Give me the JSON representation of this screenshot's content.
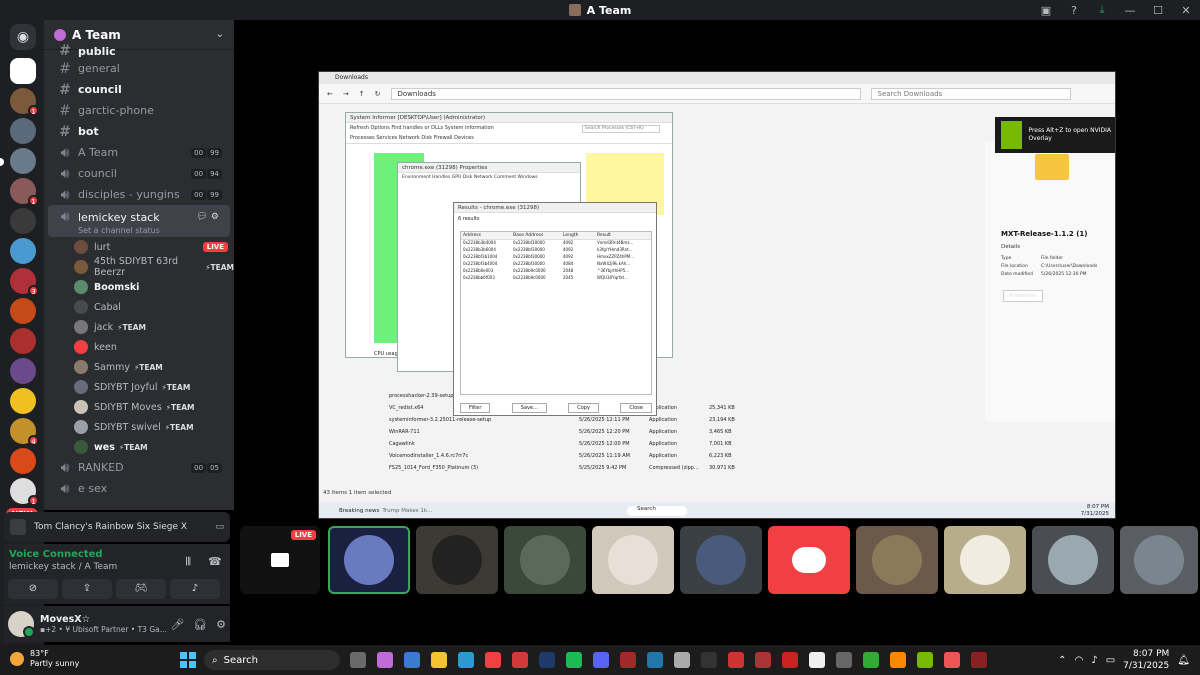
{
  "window": {
    "title": "A Team"
  },
  "guild": {
    "name": "A Team"
  },
  "server_badges": {
    "new_label": "NEW"
  },
  "channels": [
    {
      "name": "public",
      "type": "text",
      "bright": true
    },
    {
      "name": "general",
      "type": "text",
      "bright": false
    },
    {
      "name": "council",
      "type": "text",
      "bright": true
    },
    {
      "name": "garctic-phone",
      "type": "text",
      "bright": false
    },
    {
      "name": "bot",
      "type": "text",
      "bright": true
    },
    {
      "name": "A Team",
      "type": "voice",
      "counts": [
        "00",
        "99"
      ]
    },
    {
      "name": "council",
      "type": "voice",
      "counts": [
        "00",
        "94"
      ]
    },
    {
      "name": "disciples - yungins",
      "type": "voice",
      "counts": [
        "00",
        "99"
      ]
    }
  ],
  "selected_channel": {
    "name": "lemickey stack",
    "status": "Set a channel status"
  },
  "voice_users": [
    {
      "name": "lurt",
      "team": "",
      "live": "LIVE",
      "color": "#6b4e3d"
    },
    {
      "name": "45th SDIYBT 63rd Beerzr",
      "team": "⚡TEAM",
      "color": "#7a5a3a"
    },
    {
      "name": "Boomski",
      "team": "",
      "color": "#5b8c6b",
      "bright": true
    },
    {
      "name": "Cabal",
      "team": "",
      "color": "#4a4a4a"
    },
    {
      "name": "jack",
      "team": "⚡TEAM",
      "color": "#777"
    },
    {
      "name": "keen",
      "team": "",
      "color": "#f23f43"
    },
    {
      "name": "Sammy",
      "team": "⚡TEAM",
      "color": "#8a7a6a"
    },
    {
      "name": "SDIYBT Joyful",
      "team": "⚡TEAM",
      "color": "#6a6a7a"
    },
    {
      "name": "SDIYBT Moves",
      "team": "⚡TEAM",
      "color": "#c9c2b5"
    },
    {
      "name": "SDIYBT swivel",
      "team": "⚡TEAM",
      "color": "#9aa0a8"
    },
    {
      "name": "wes",
      "team": "⚡TEAM",
      "color": "#3a5a3a",
      "bright": true
    }
  ],
  "after_channels": [
    {
      "name": "RANKED",
      "type": "voice",
      "counts": [
        "00",
        "05"
      ]
    },
    {
      "name": "e sex",
      "type": "voice"
    }
  ],
  "activity": {
    "game": "Tom Clancy's Rainbow Six Siege X"
  },
  "voice": {
    "status": "Voice Connected",
    "location": "lemickey stack / A Team"
  },
  "user": {
    "name": "MovesX☆",
    "status": "▪+2 • ¥ Ubisoft Partner • T3 Ga..."
  },
  "stream": {
    "explorer_title": "Downloads",
    "address": "Downloads",
    "search_placeholder": "Search Downloads",
    "status_bar": "43 items   1 item selected",
    "informer_title": "System Informer [DESKTOP\\User] (Administrator)",
    "informer_tabs": "Processes  Services  Network  Disk  Firewall  Devices",
    "informer_toolbar": "Refresh  Options  Find handles or DLLs  System information",
    "search_processes": "Search Processes (Ctrl+K)",
    "cpu_usage": "CPU usage: 16.60%",
    "props_title": "chrome.exe (31298) Properties",
    "props_tabs": "Environment  Handles  GPU  Disk  Network  Comment  Windows",
    "results_title": "Results - chrome.exe (31298)",
    "results_count": "6 results",
    "results_headers": [
      "Address",
      "Base Address",
      "Length",
      "Result"
    ],
    "results_rows": [
      [
        "0x2238b3b4004",
        "0x2238bf30000",
        "4092",
        "Vnmd3Rnt4Bmz..."
      ],
      [
        "0x2238b3b6004",
        "0x2238bf30000",
        "4092",
        "k3fgrYHmd3Rnt..."
      ],
      [
        "0x2238bf3b1004",
        "0x2238bf30000",
        "4092",
        "HmxxZZPZ4hPM..."
      ],
      [
        "0x2238bf3b4004",
        "0x2238bf30000",
        "4084",
        "NxW42j9k.kAh..."
      ],
      [
        "0x2238b6e003",
        "0x2238b9c0000",
        "2048",
        "^36YbjrthHP5..."
      ],
      [
        "0x2238bb6f003",
        "0x2238b9c0000",
        "2045",
        "WQU30Yqrfxt..."
      ]
    ],
    "results_buttons": [
      "Filter",
      "Save...",
      "Copy",
      "Close"
    ],
    "files": [
      [
        "processhacker-2.39-setup",
        "",
        "",
        ""
      ],
      [
        "VC_redist.x64",
        "5/26/2025 12:44 PM",
        "Application",
        "25,341 KB"
      ],
      [
        "systeminformer-3.2.25011-release-setup",
        "5/26/2025 12:11 PM",
        "Application",
        "23,194 KB"
      ],
      [
        "WinRAR-711",
        "5/26/2025 12:20 PM",
        "Application",
        "3,465 KB"
      ],
      [
        "Cagawlink",
        "5/26/2025 12:00 PM",
        "Application",
        "7,001 KB"
      ],
      [
        "VoicemodInstaller_1.4.6.rc7rr7c",
        "5/26/2025 11:19 AM",
        "Application",
        "6,223 KB"
      ],
      [
        "FS25_1014_Ford_F350_Platinum (3)",
        "5/25/2025 9:42 PM",
        "Compressed (zipp...",
        "30,971 KB"
      ]
    ],
    "details_title": "MXT-Release-1.1.2 (1)",
    "details_rows": [
      [
        "Type",
        "File folder"
      ],
      [
        "File location",
        "C:\\Users\\user\\Downloads"
      ],
      [
        "Date modified",
        "5/26/2025 12:30 PM"
      ]
    ],
    "details_button": "Properties",
    "overlay_text": "Press Alt+Z to open NVIDIA Overlay",
    "news": "Breaking news",
    "news_sub": "Trump Makes 1k...",
    "inner_search": "Search",
    "inner_time": "8:07 PM",
    "inner_date": "7/31/2025"
  },
  "tiles": {
    "live_label": "LIVE"
  },
  "taskbar": {
    "temperature": "83°F",
    "weather": "Partly sunny",
    "search_placeholder": "Search",
    "time": "8:07 PM",
    "date": "7/31/2025"
  }
}
